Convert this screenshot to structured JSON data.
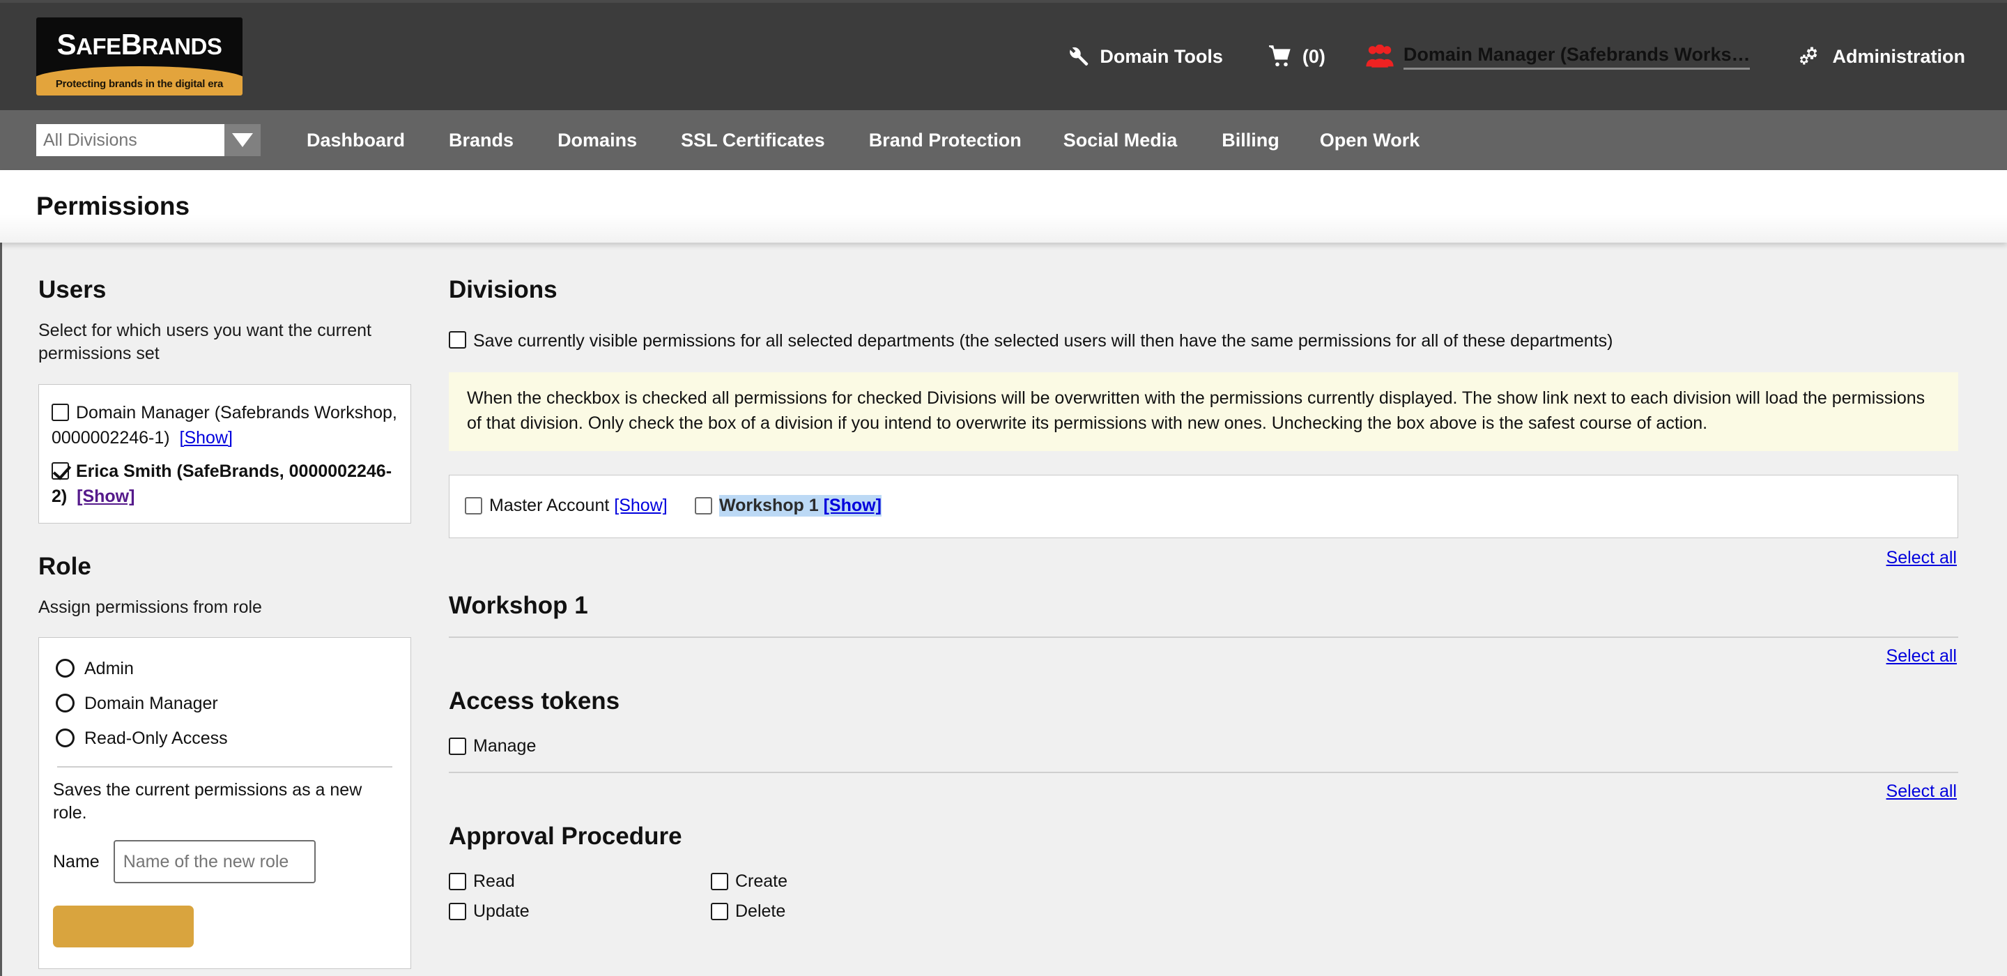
{
  "brand": {
    "logo_main": "SAFEBRANDS",
    "logo_s": "S",
    "logo_afe": "AFE",
    "logo_b": "B",
    "logo_rands": "RANDS",
    "logo_tagline": "Protecting brands in the digital era"
  },
  "topbar": {
    "domain_tools": "Domain Tools",
    "cart_count": "(0)",
    "user": "Domain Manager (Safebrands Works…",
    "administration": "Administration"
  },
  "menubar": {
    "division_placeholder": "All Divisions",
    "items": [
      "Dashboard",
      "Brands",
      "Domains",
      "SSL Certificates",
      "Brand Protection",
      "Social Media",
      "Billing",
      "Open Work"
    ]
  },
  "page": {
    "title": "Permissions"
  },
  "users_section": {
    "heading": "Users",
    "description": "Select for which users you want the current permissions set",
    "items": [
      {
        "label": "Domain Manager (Safebrands Workshop, 0000002246-1)",
        "show": "[Show]",
        "checked": false,
        "visited": false
      },
      {
        "label": "Erica Smith (SafeBrands, 0000002246-2)",
        "show": "[Show]",
        "checked": true,
        "visited": true
      }
    ]
  },
  "role_section": {
    "heading": "Role",
    "description": "Assign permissions from role",
    "options": [
      "Admin",
      "Domain Manager",
      "Read-Only Access"
    ],
    "save_note": "Saves the current permissions as a new role.",
    "name_label": "Name",
    "name_value": "",
    "name_placeholder": "Name of the new role",
    "button_label": ""
  },
  "divisions_section": {
    "heading": "Divisions",
    "save_all_label": "Save currently visible permissions for all selected departments (the selected users will then have the same permissions for all of these departments)",
    "warning": "When the checkbox is checked all permissions for checked Divisions will be overwritten with the permissions currently displayed. The show link next to each division will load the permissions of that division. Only check the box of a division if you intend to overwrite its permissions with new ones. Unchecking the box above is the safest course of action.",
    "divisions": [
      {
        "name": "Master Account",
        "show": "[Show]",
        "checked": false,
        "selected": false
      },
      {
        "name": "Workshop 1",
        "show": "[Show]",
        "checked": false,
        "selected": true
      }
    ],
    "select_all_label": "Select all"
  },
  "workshop": {
    "title": "Workshop 1",
    "select_all_label": "Select all",
    "groups": [
      {
        "title": "Access tokens",
        "permissions": [
          [
            "Manage",
            ""
          ]
        ],
        "select_all_label": "Select all"
      },
      {
        "title": "Approval Procedure",
        "permissions": [
          [
            "Read",
            "Create"
          ],
          [
            "Update",
            "Delete"
          ]
        ],
        "select_all_label": "Select all"
      }
    ]
  },
  "colors": {
    "topbar_bg": "#3c3c3c",
    "menubar_bg": "#646464",
    "page_bg": "#f0f0f0",
    "accent_gold": "#d9a43e",
    "logo_band": "#e3a43c",
    "link_blue": "#0000dd",
    "link_visited": "#551a8b",
    "warning_bg": "#fbfae4",
    "selection_blue": "#bcd9f5",
    "user_icon_red": "#ee2222"
  }
}
